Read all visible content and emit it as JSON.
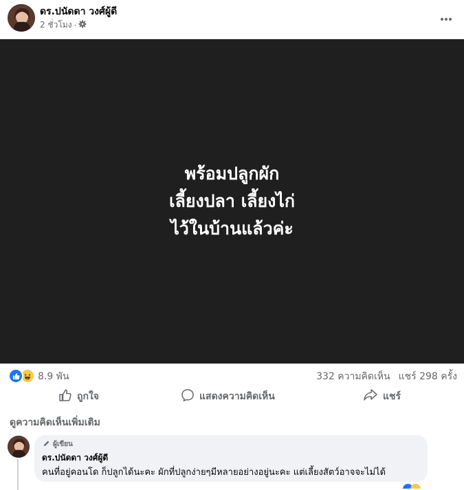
{
  "post": {
    "author": "ดร.ปนัดดา วงศ์ผู้ดี",
    "timestamp": "2 ชั่วโมง",
    "separator": "·",
    "audience_icon": "gear-icon",
    "image_text": [
      "พร้อมปลูกผัก",
      "เลี้ยงปลา เลี้ยงไก่",
      "ไว้ในบ้านแล้วค่ะ"
    ]
  },
  "stats": {
    "reaction_icons": [
      "like-icon",
      "haha-icon"
    ],
    "reaction_count": "8.9 พัน",
    "comments": "332 ความคิดเห็น",
    "shares": "แชร์ 298 ครั้ง"
  },
  "actions": {
    "like": "ถูกใจ",
    "comment": "แสดงความคิดเห็น",
    "share": "แชร์"
  },
  "comments_section": {
    "view_more": "ดูความคิดเห็นเพิ่มเติม",
    "comment": {
      "badge": "ผู้เขียน",
      "author": "ดร.ปนัดดา วงศ์ผู้ดี",
      "text": "คนที่อยู่คอนโด ก็ปลูกได้นะคะ ผักที่ปลูกง่ายๆมีหลายอย่างอยู่นะคะ แต่เลี้ยงสัตว์อาจจะไม่ได้"
    }
  },
  "colors": {
    "facebook_blue": "#1877f2",
    "image_bg": "#1f1f1f",
    "muted_text": "#65676b",
    "bubble_bg": "#f0f2f5"
  }
}
